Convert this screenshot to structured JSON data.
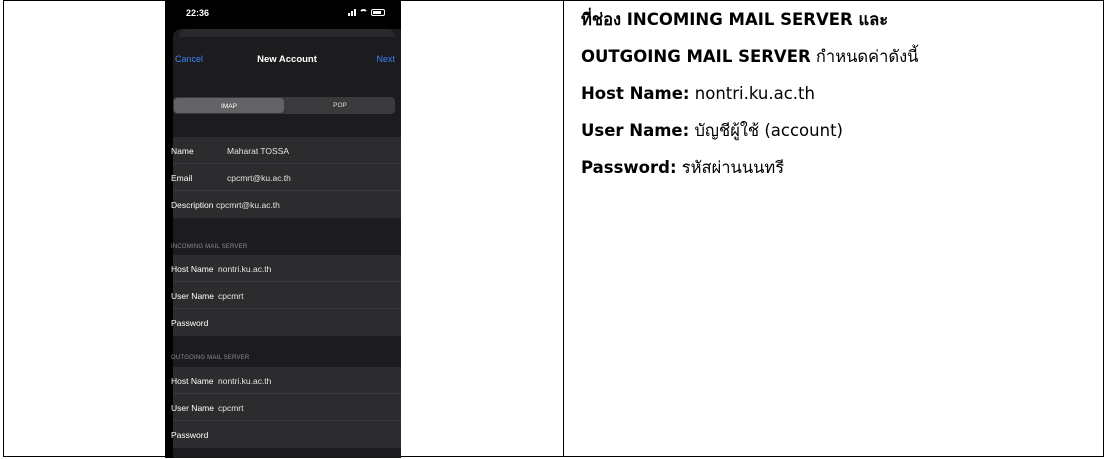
{
  "phone": {
    "status_time": "22:36",
    "nav": {
      "cancel": "Cancel",
      "title": "New Account",
      "next": "Next"
    },
    "segments": [
      "IMAP",
      "POP"
    ],
    "account": [
      {
        "label": "Name",
        "value": "Maharat TOSSA"
      },
      {
        "label": "Email",
        "value": "cpcmrt@ku.ac.th"
      },
      {
        "label": "Description",
        "value": "cpcmrt@ku.ac.th"
      }
    ],
    "incoming_header": "INCOMING MAIL SERVER",
    "incoming": [
      {
        "label": "Host Name",
        "value": "nontri.ku.ac.th"
      },
      {
        "label": "User Name",
        "value": "cpcmrt"
      },
      {
        "label": "Password",
        "value": ""
      }
    ],
    "outgoing_header": "OUTGOING MAIL SERVER",
    "outgoing": [
      {
        "label": "Host Name",
        "value": "nontri.ku.ac.th"
      },
      {
        "label": "User Name",
        "value": "cpcmrt"
      },
      {
        "label": "Password",
        "value": ""
      }
    ],
    "accent_color": "#3b82f6"
  },
  "instructions": {
    "line1_bold": "ที่ช่อง INCOMING MAIL SERVER และ",
    "line2_bold": "OUTGOING MAIL SERVER",
    "line2_rest": " กำหนดค่าดังนี้",
    "host_label": "Host Name:",
    "host_value": " nontri.ku.ac.th",
    "user_label": "User Name:",
    "user_value": " บัญชีผู้ใช้ (account)",
    "pass_label": "Password:",
    "pass_value": " รหัสผ่านนนทรี"
  }
}
